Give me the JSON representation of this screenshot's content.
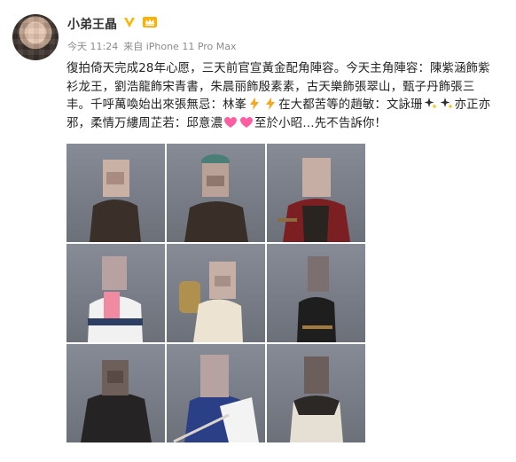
{
  "user": {
    "name": "小弟王晶",
    "verified_icon": "verified-v-icon",
    "vip_icon": "vip-crown-icon"
  },
  "meta": {
    "time": "今天 11:24",
    "source": "来自 iPhone 11 Pro Max"
  },
  "post": {
    "lines": [
      "復拍倚天完成28年心愿，三天前官宣黃金配角陣容。今天主角陣容：陳紫涵飾紫",
      "衫龙王，劉浩龍飾宋青書，朱晨丽飾殷素素，古天樂飾張翠山，甄子丹飾張三",
      "丰。千呼萬喚始出來張無忌：林峯",
      "在大都苦等的趙敏：文詠珊",
      "亦正亦",
      "邪，柔情万縷周芷若：邱意濃",
      "至於小昭…先不告訴你！"
    ],
    "emojis": [
      "lightning-icon",
      "lightning-icon",
      "sparkle-icon",
      "sparkle-icon",
      "heart-icon",
      "heart-icon"
    ]
  },
  "photos": [
    {
      "name": "photo-1"
    },
    {
      "name": "photo-2"
    },
    {
      "name": "photo-3"
    },
    {
      "name": "photo-4"
    },
    {
      "name": "photo-5"
    },
    {
      "name": "photo-6"
    },
    {
      "name": "photo-7"
    },
    {
      "name": "photo-8"
    },
    {
      "name": "photo-9"
    }
  ],
  "colors": {
    "text": "#222222",
    "meta": "#8b8b8b",
    "verified": "#f7b500",
    "heart": "#ff5fa2",
    "lightning": "#f5a623",
    "sparkle": "#2d2d2d"
  }
}
